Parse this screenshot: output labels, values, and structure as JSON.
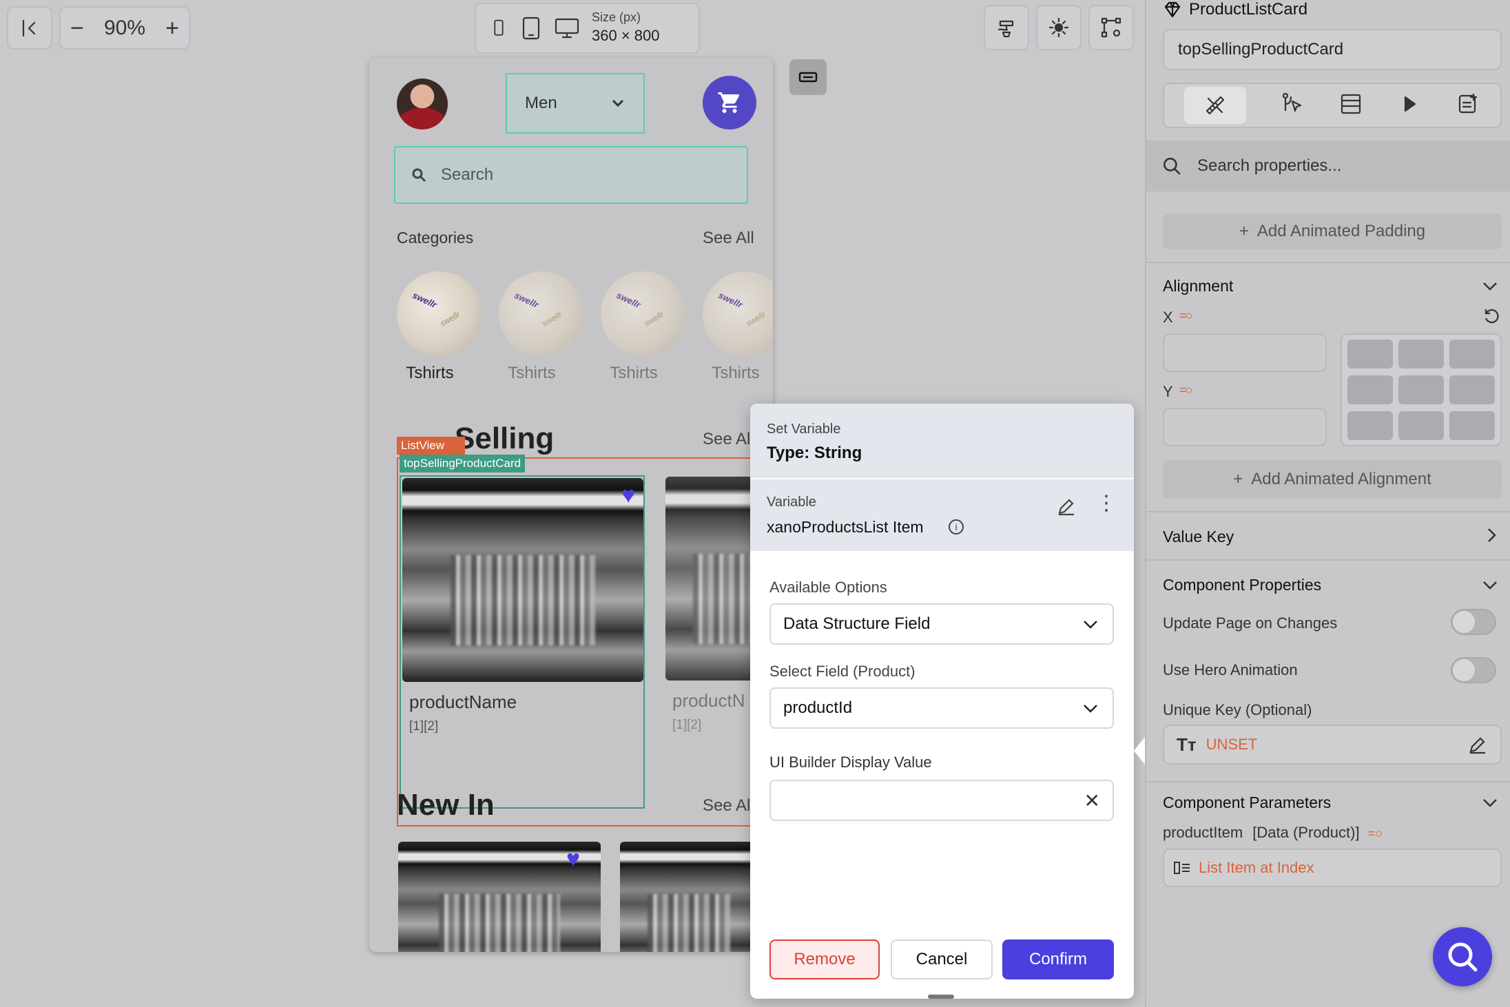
{
  "toolbar": {
    "zoom": "90%",
    "size_label": "Size (px)",
    "size_value": "360 × 800"
  },
  "canvas": {
    "dropdown_value": "Men",
    "search_placeholder": "Search",
    "categories_title": "Categories",
    "categories_see_all": "See All",
    "categories": [
      {
        "label": "Tshirts",
        "brand": "swellr"
      },
      {
        "label": "Tshirts",
        "brand": "swellr"
      },
      {
        "label": "Tshirts",
        "brand": "swellr"
      },
      {
        "label": "Tshirts",
        "brand": "swellr"
      }
    ],
    "top_selling_title_visible": "Selling",
    "top_selling_see_all": "See Al",
    "listview_tag": "ListView",
    "card_tag": "topSellingProductCard",
    "product_cards": [
      {
        "name": "productName",
        "sub": "[1][2]"
      },
      {
        "name": "productN",
        "sub": "[1][2]"
      }
    ],
    "new_in_title": "New In",
    "new_in_see_all": "See Al"
  },
  "dialog": {
    "header_label": "Set Variable",
    "header_type": "Type: String",
    "variable_label": "Variable",
    "variable_value": "xanoProductsList Item",
    "available_options_label": "Available Options",
    "available_options_value": "Data Structure Field",
    "select_field_label": "Select Field (Product)",
    "select_field_value": "productId",
    "display_value_label": "UI Builder Display Value",
    "display_value": "",
    "remove_label": "Remove",
    "cancel_label": "Cancel",
    "confirm_label": "Confirm"
  },
  "panel": {
    "component_name": "ProductListCard",
    "instance_name": "topSellingProductCard",
    "search_placeholder": "Search properties...",
    "add_padding_label": "Add Animated Padding",
    "alignment_title": "Alignment",
    "x_label": "X",
    "y_label": "Y",
    "add_alignment_label": "Add Animated Alignment",
    "value_key_title": "Value Key",
    "component_props_title": "Component Properties",
    "update_page_label": "Update Page on Changes",
    "hero_anim_label": "Use Hero Animation",
    "unique_key_label": "Unique Key (Optional)",
    "unique_key_value": "UNSET",
    "component_params_title": "Component Parameters",
    "param_label": "productItem",
    "param_type": "[Data (Product)]",
    "param_value": "List Item at Index"
  },
  "colors": {
    "accent": "#4b3fe0",
    "teal_selection": "#5fc9b8",
    "orange_selection": "#d9633a",
    "unset_text": "#d9633a",
    "remove_red": "#d9423a"
  }
}
